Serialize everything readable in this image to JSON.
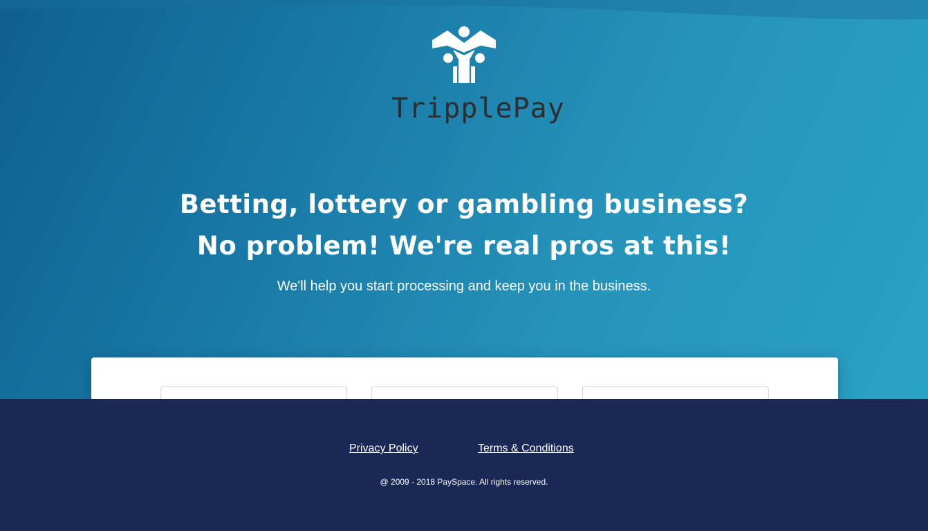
{
  "brand": {
    "name": "TripplePay",
    "logo_icon": "three-people-logo-icon",
    "colors": {
      "hero_start": "#0f5f8f",
      "hero_end": "#2aa2c3",
      "footer": "#1a2855",
      "wordmark": "#2e2e2e"
    }
  },
  "hero": {
    "headline_line1": "Betting, lottery or gambling business?",
    "headline_line2": "No problem! We're real pros at this!",
    "subline": "We'll help you start processing and keep you in the business."
  },
  "footer": {
    "privacy_label": "Privacy Policy",
    "terms_label": "Terms & Conditions",
    "copyright": "@ 2009 - 2018 PaySpace. All rights reserved."
  }
}
